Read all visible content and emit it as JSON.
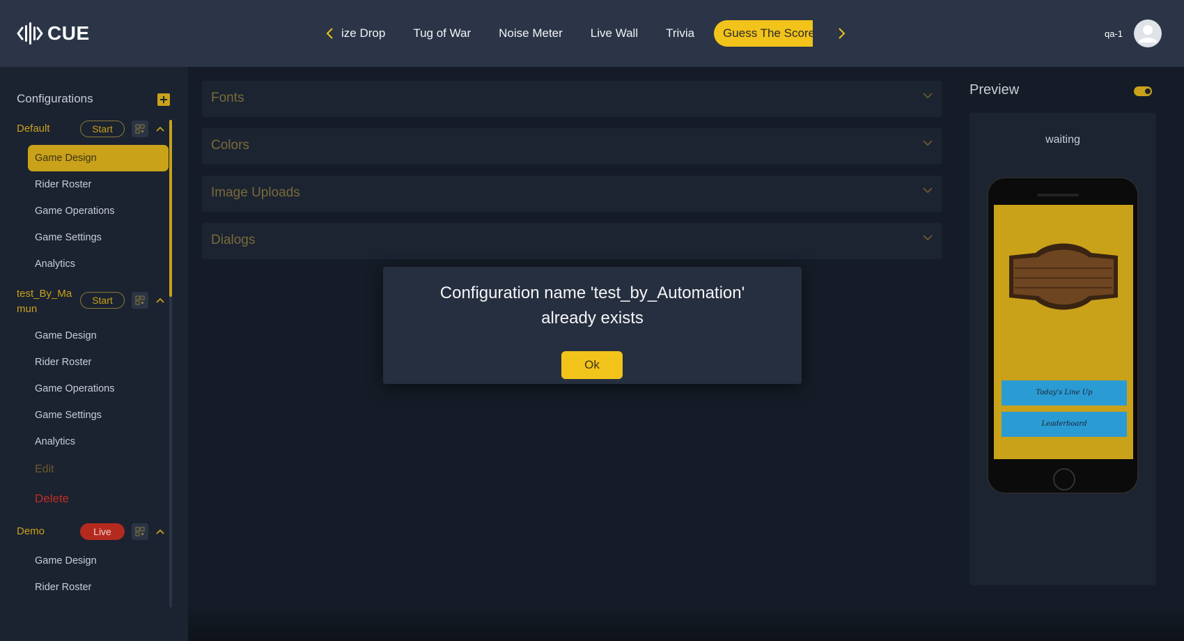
{
  "app": {
    "logo_text": "CUE"
  },
  "nav": {
    "items": [
      "ize Drop",
      "Tug of War",
      "Noise Meter",
      "Live Wall",
      "Trivia"
    ],
    "active": "Guess The Score"
  },
  "user": {
    "name": "qa-1"
  },
  "sidebar": {
    "title": "Configurations",
    "configs": [
      {
        "name": "Default",
        "badge": "Start",
        "items": [
          "Game Design",
          "Rider Roster",
          "Game Operations",
          "Game Settings",
          "Analytics"
        ]
      },
      {
        "name_line1": "test_By_Ma",
        "name_line2": "mun",
        "badge": "Start",
        "items": [
          "Game Design",
          "Rider Roster",
          "Game Operations",
          "Game Settings",
          "Analytics"
        ],
        "edit": "Edit",
        "delete": "Delete"
      },
      {
        "name": "Demo",
        "badge": "Live",
        "items": [
          "Game Design",
          "Rider Roster"
        ]
      }
    ]
  },
  "main": {
    "sections": [
      "Fonts",
      "Colors",
      "Image Uploads",
      "Dialogs"
    ]
  },
  "preview": {
    "title": "Preview",
    "status": "waiting",
    "buttons": [
      "Today's Line Up",
      "Leaderboard"
    ]
  },
  "modal": {
    "line1": "Configuration name 'test_by_Automation'",
    "line2": "already exists",
    "ok": "Ok"
  },
  "colors": {
    "accent": "#f2c31a",
    "header": "#2b3547",
    "live": "#b42a1f"
  }
}
